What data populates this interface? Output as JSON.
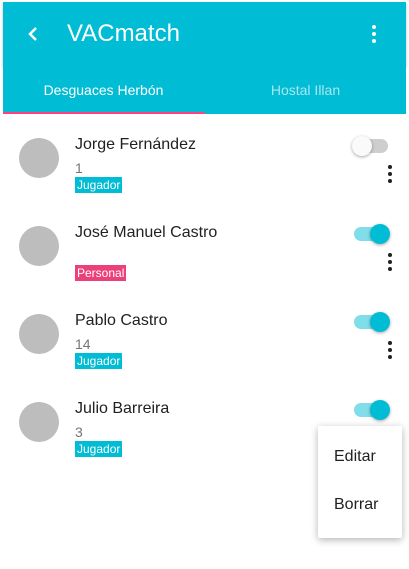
{
  "app": {
    "title": "VACmatch"
  },
  "icons": {
    "back": "chevron-left-icon",
    "more": "more-vertical-icon"
  },
  "tabs": [
    {
      "label": "Desguaces Herbón",
      "active": true
    },
    {
      "label": "Hostal Illan",
      "active": false
    }
  ],
  "colors": {
    "primary": "#00bcd4",
    "accent": "#ff4081",
    "badge_jugador": "#00bcd4",
    "badge_personal": "#ec407a",
    "toggle_off_track": "#9e9e9e",
    "toggle_off_thumb": "#fafafa",
    "toggle_on_track": "#80deea",
    "toggle_on_thumb": "#00bcd4"
  },
  "members": [
    {
      "name": "Jorge Fernández",
      "number": "1",
      "role": "Jugador",
      "enabled": false
    },
    {
      "name": "José Manuel Castro",
      "number": "",
      "role": "Personal",
      "enabled": true
    },
    {
      "name": "Pablo Castro",
      "number": "14",
      "role": "Jugador",
      "enabled": true
    },
    {
      "name": "Julio Barreira",
      "number": "3",
      "role": "Jugador",
      "enabled": true
    }
  ],
  "context_menu": {
    "items": [
      "Editar",
      "Borrar"
    ]
  }
}
